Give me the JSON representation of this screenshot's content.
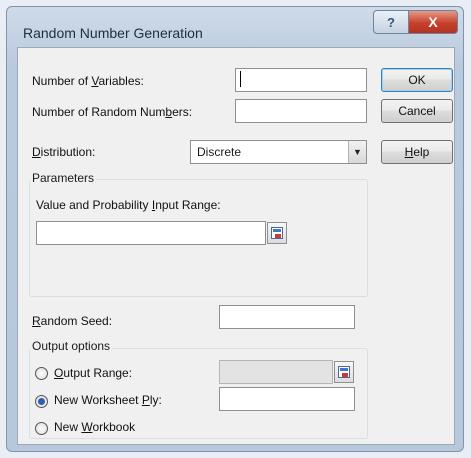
{
  "window": {
    "title": "Random Number Generation",
    "help_glyph": "?",
    "close_glyph": "X"
  },
  "labels": {
    "num_variables_pre": "Number of ",
    "num_variables_acc": "V",
    "num_variables_post": "ariables:",
    "num_random_pre": "Number of Random Num",
    "num_random_acc": "b",
    "num_random_post": "ers:",
    "distribution_acc": "D",
    "distribution_post": "istribution:",
    "parameters": "Parameters",
    "value_prob_pre": "Value and Probability ",
    "value_prob_acc": "I",
    "value_prob_post": "nput Range:",
    "random_seed_acc": "R",
    "random_seed_post": "andom Seed:",
    "output_options": "Output options",
    "output_range_acc": "O",
    "output_range_post": "utput Range:",
    "new_ws_pre": "New Worksheet ",
    "new_ws_acc": "P",
    "new_ws_post": "ly:",
    "new_wb_pre": "New ",
    "new_wb_acc": "W",
    "new_wb_post": "orkbook"
  },
  "buttons": {
    "ok": "OK",
    "cancel": "Cancel",
    "help_acc": "H",
    "help_post": "elp"
  },
  "distribution": {
    "selected": "Discrete"
  },
  "inputs": {
    "num_variables": "",
    "num_random": "",
    "value_prob_range": "",
    "random_seed": "",
    "output_range": "",
    "new_ws_ply": ""
  },
  "output": {
    "selected": "new_worksheet_ply"
  },
  "colors": {
    "accent": "#3c7fb1",
    "close": "#c7402a"
  }
}
